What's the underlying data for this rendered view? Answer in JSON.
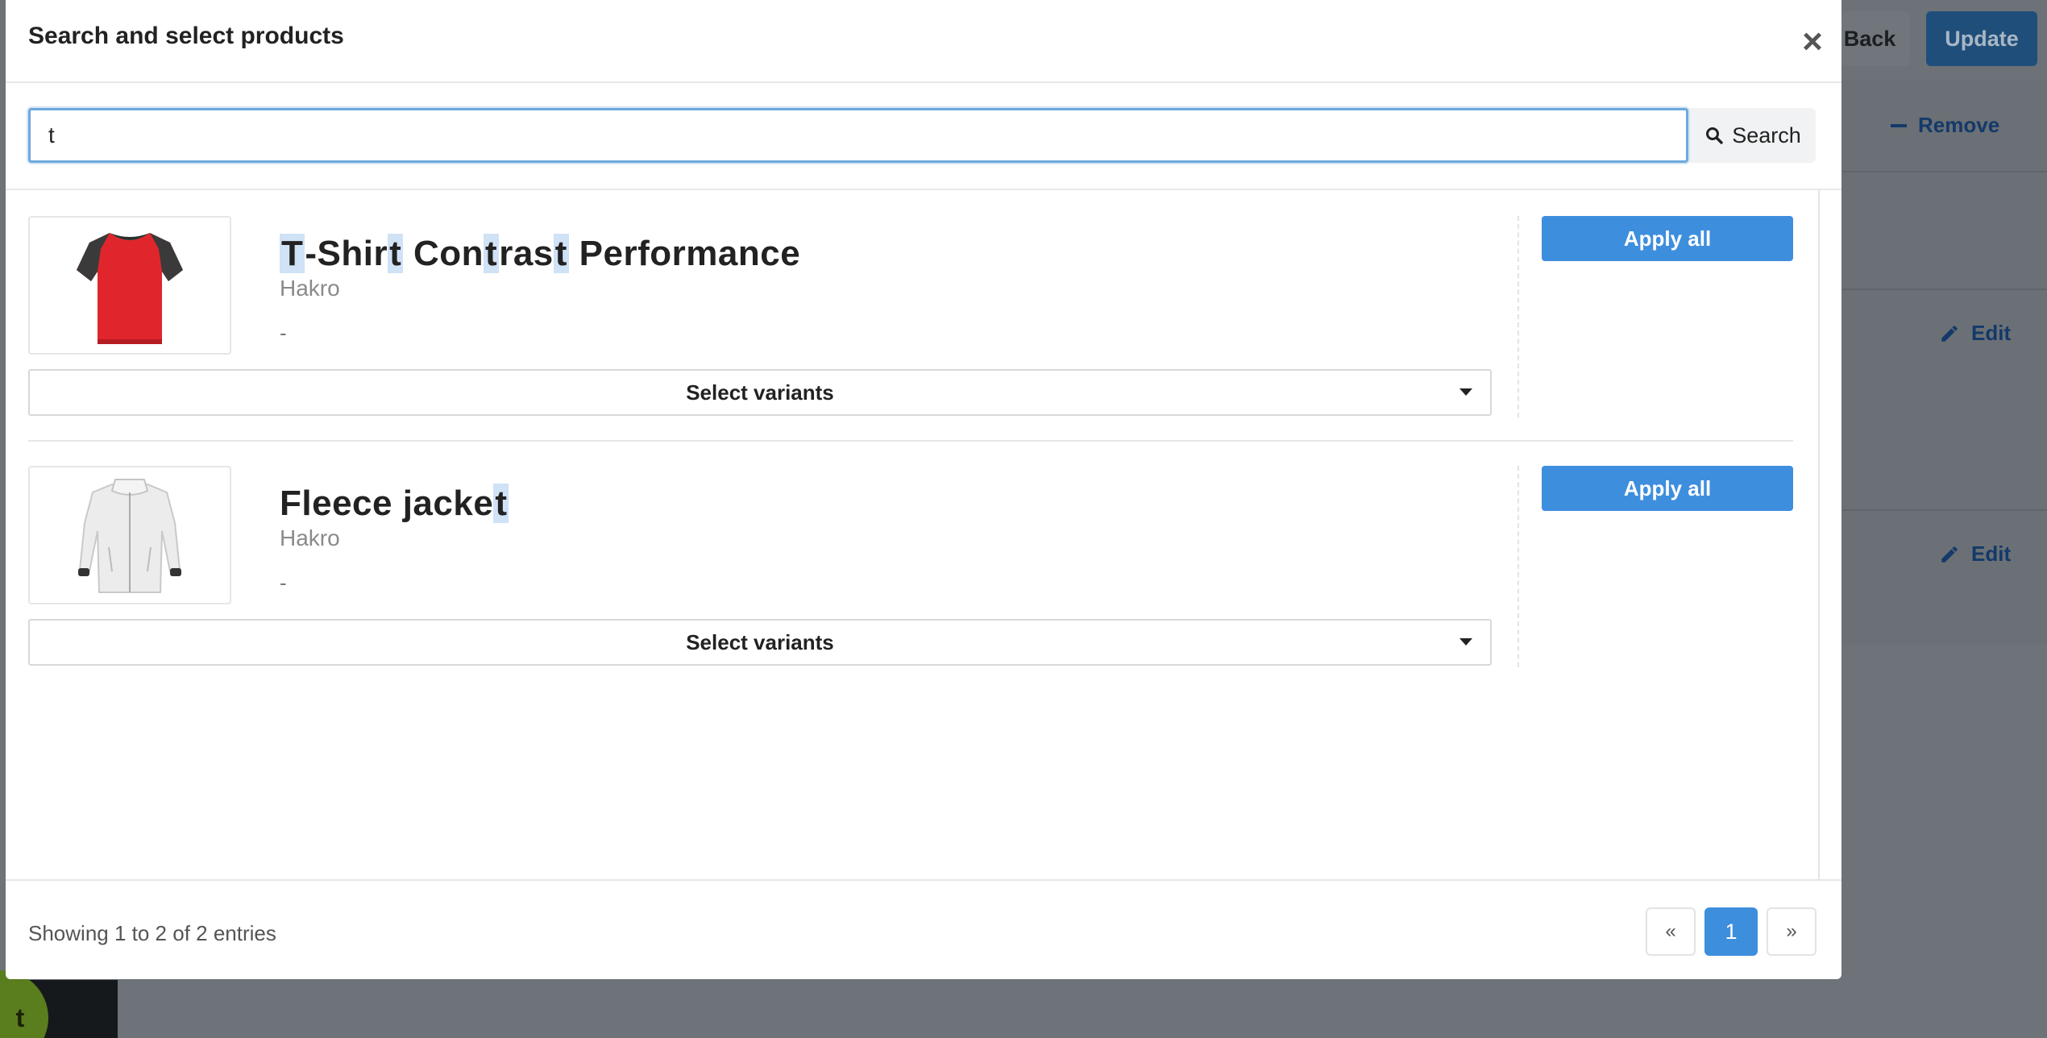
{
  "background": {
    "back_label": "Back",
    "update_label": "Update",
    "remove_label": "Remove",
    "edit_label_1": "Edit",
    "edit_label_2": "Edit",
    "fragment": "n",
    "bubble_label": "t"
  },
  "modal": {
    "title": "Search and select products",
    "close_glyph": "×",
    "search": {
      "value": "t",
      "button_label": "Search"
    },
    "products": [
      {
        "name_segments": [
          "T",
          "-Shir",
          "t",
          " Con",
          "t",
          "ras",
          "t",
          " Performance"
        ],
        "brand": "Hakro",
        "detail": "-",
        "apply_label": "Apply all",
        "select_label": "Select variants",
        "thumb_icon": "red-tshirt-icon"
      },
      {
        "name_segments": [
          "Fleece jacke",
          "t"
        ],
        "brand": "Hakro",
        "detail": "-",
        "apply_label": "Apply all",
        "select_label": "Select variants",
        "thumb_icon": "white-fleece-jacket-icon"
      }
    ],
    "footer": {
      "info": "Showing 1 to 2 of 2 entries",
      "prev": "«",
      "page": "1",
      "next": "»"
    }
  },
  "colors": {
    "primary": "#3e8ede",
    "highlight": "#cfe2f6",
    "backdrop": "#6d7378"
  }
}
